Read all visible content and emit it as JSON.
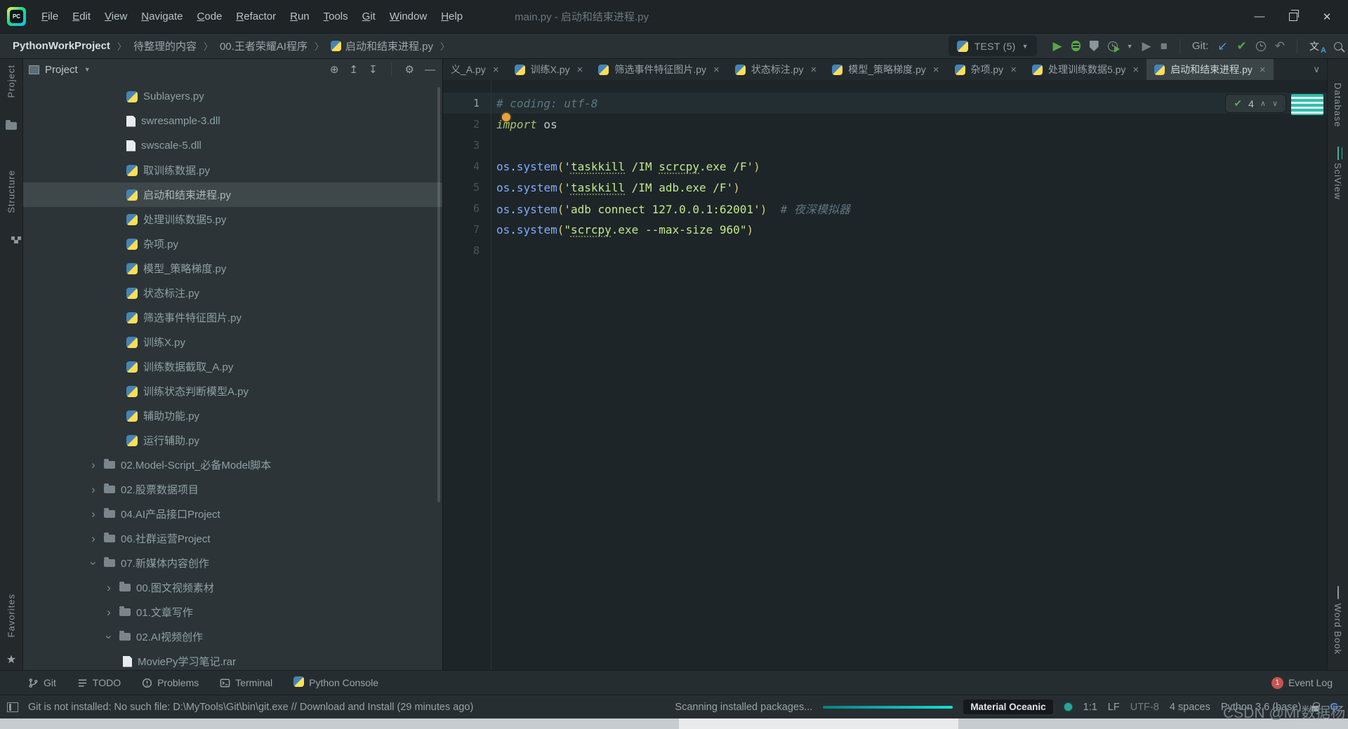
{
  "titlebar": {
    "menu": [
      "File",
      "Edit",
      "View",
      "Navigate",
      "Code",
      "Refactor",
      "Run",
      "Tools",
      "Git",
      "Window",
      "Help"
    ],
    "window_title": "main.py - 启动和结束进程.py"
  },
  "navbar": {
    "breadcrumbs": [
      {
        "label": "PythonWorkProject",
        "bold": true
      },
      {
        "label": "待整理的内容"
      },
      {
        "label": "00.王者荣耀AI程序"
      },
      {
        "label": "启动和结束进程.py",
        "icon": "python"
      }
    ],
    "run_config": "TEST (5)",
    "git_label": "Git:"
  },
  "stripes": {
    "left": [
      {
        "label": "Project"
      },
      {
        "label": "Structure"
      }
    ],
    "left_bottom": {
      "label": "Favorites"
    },
    "right": [
      {
        "label": "Database"
      },
      {
        "label": "SciView"
      }
    ],
    "right_bottom": {
      "label": "Word Book"
    }
  },
  "project": {
    "title": "Project",
    "tree": [
      {
        "label": "Sublayers.py",
        "icon": "python",
        "ind": "file"
      },
      {
        "label": "swresample-3.dll",
        "icon": "file",
        "ind": "file"
      },
      {
        "label": "swscale-5.dll",
        "icon": "file",
        "ind": "file"
      },
      {
        "label": "取训练数据.py",
        "icon": "python",
        "ind": "file"
      },
      {
        "label": "启动和结束进程.py",
        "icon": "python",
        "ind": "file",
        "selected": true
      },
      {
        "label": "处理训练数据5.py",
        "icon": "python",
        "ind": "file"
      },
      {
        "label": "杂项.py",
        "icon": "python",
        "ind": "file"
      },
      {
        "label": "模型_策略梯度.py",
        "icon": "python",
        "ind": "file"
      },
      {
        "label": "状态标注.py",
        "icon": "python",
        "ind": "file"
      },
      {
        "label": "筛选事件特征图片.py",
        "icon": "python",
        "ind": "file"
      },
      {
        "label": "训练X.py",
        "icon": "python",
        "ind": "file"
      },
      {
        "label": "训练数据截取_A.py",
        "icon": "python",
        "ind": "file"
      },
      {
        "label": "训练状态判断模型A.py",
        "icon": "python",
        "ind": "file"
      },
      {
        "label": "辅助功能.py",
        "icon": "python",
        "ind": "file"
      },
      {
        "label": "运行辅助.py",
        "icon": "python",
        "ind": "file"
      },
      {
        "label": "02.Model-Script_必备Model脚本",
        "icon": "folder",
        "ind": "folder1",
        "chevron": "collapsed"
      },
      {
        "label": "02.股票数据项目",
        "icon": "folder",
        "ind": "folder1",
        "chevron": "collapsed"
      },
      {
        "label": "04.AI产品接口Project",
        "icon": "folder",
        "ind": "folder1",
        "chevron": "collapsed"
      },
      {
        "label": "06.社群运营Project",
        "icon": "folder",
        "ind": "folder1",
        "chevron": "collapsed"
      },
      {
        "label": "07.新媒体内容创作",
        "icon": "folder",
        "ind": "folder1",
        "chevron": "expanded"
      },
      {
        "label": "00.图文视频素材",
        "icon": "folder",
        "ind": "folder2",
        "chevron": "collapsed"
      },
      {
        "label": "01.文章写作",
        "icon": "folder",
        "ind": "folder2",
        "chevron": "collapsed"
      },
      {
        "label": "02.AI视频创作",
        "icon": "folder",
        "ind": "folder2",
        "chevron": "expanded"
      },
      {
        "label": "MoviePy学习笔记.rar",
        "icon": "file",
        "ind": "file2"
      }
    ]
  },
  "editor": {
    "tabs": [
      {
        "label": "义_A.py",
        "icon": false
      },
      {
        "label": "训练X.py",
        "icon": true
      },
      {
        "label": "筛选事件特征图片.py",
        "icon": true
      },
      {
        "label": "状态标注.py",
        "icon": true
      },
      {
        "label": "模型_策略梯度.py",
        "icon": true
      },
      {
        "label": "杂项.py",
        "icon": true
      },
      {
        "label": "处理训练数据5.py",
        "icon": true
      },
      {
        "label": "启动和结束进程.py",
        "icon": true,
        "active": true
      }
    ],
    "inspections_count": "4",
    "code_lines": [
      [
        [
          "# coding: utf-8",
          "cm"
        ]
      ],
      [
        [
          "import",
          "kw"
        ],
        [
          " os",
          "pl"
        ]
      ],
      [],
      [
        [
          "os",
          "nm"
        ],
        [
          ".",
          "dt"
        ],
        [
          "system",
          "nm"
        ],
        [
          "(",
          "pr"
        ],
        [
          "'",
          "st"
        ],
        [
          "taskkill",
          "ty"
        ],
        [
          " /IM ",
          "st"
        ],
        [
          "scrcpy",
          "ty"
        ],
        [
          ".exe /F",
          "st"
        ],
        [
          "'",
          "st"
        ],
        [
          ")",
          "pr"
        ]
      ],
      [
        [
          "os",
          "nm"
        ],
        [
          ".",
          "dt"
        ],
        [
          "system",
          "nm"
        ],
        [
          "(",
          "pr"
        ],
        [
          "'",
          "st"
        ],
        [
          "taskkill",
          "ty"
        ],
        [
          " /IM adb.exe /F",
          "st"
        ],
        [
          "'",
          "st"
        ],
        [
          ")",
          "pr"
        ]
      ],
      [
        [
          "os",
          "nm"
        ],
        [
          ".",
          "dt"
        ],
        [
          "system",
          "nm"
        ],
        [
          "(",
          "pr"
        ],
        [
          "'adb connect 127.0.0.1:62001'",
          "st"
        ],
        [
          ")",
          "pr"
        ],
        [
          "  ",
          "pl"
        ],
        [
          "# 夜深模拟器",
          "cm"
        ]
      ],
      [
        [
          "os",
          "nm"
        ],
        [
          ".",
          "dt"
        ],
        [
          "system",
          "nm"
        ],
        [
          "(",
          "pr"
        ],
        [
          "\"",
          "st"
        ],
        [
          "scrcpy",
          "ty"
        ],
        [
          ".exe --max-size 960",
          "st"
        ],
        [
          "\"",
          "st"
        ],
        [
          ")",
          "pr"
        ]
      ],
      []
    ]
  },
  "bottom_bar": {
    "items": [
      {
        "label": "Git",
        "icon": "git"
      },
      {
        "label": "TODO",
        "icon": "todo"
      },
      {
        "label": "Problems",
        "icon": "problems"
      },
      {
        "label": "Terminal",
        "icon": "terminal"
      },
      {
        "label": "Python Console",
        "icon": "python"
      }
    ],
    "event_log": {
      "badge": "1",
      "label": "Event Log"
    }
  },
  "status_bar": {
    "message": "Git is not installed: No such file: D:\\MyTools\\Git\\bin\\git.exe // Download and Install (29 minutes ago)",
    "scanning": "Scanning installed packages...",
    "theme": "Material Oceanic",
    "caret": "1:1",
    "line_ending": "LF",
    "encoding": "UTF-8",
    "indent": "4 spaces",
    "interpreter": "Python 3.6 (base)"
  },
  "watermark": "CSDN @Mr数据杨",
  "colors": {
    "accent_teal": "#26A69A",
    "run_green": "#57A64B",
    "string_green": "#C3E88D",
    "function_blue": "#82AAFF",
    "progress_teal": "#12E0D2",
    "badge_red": "#C75450"
  }
}
